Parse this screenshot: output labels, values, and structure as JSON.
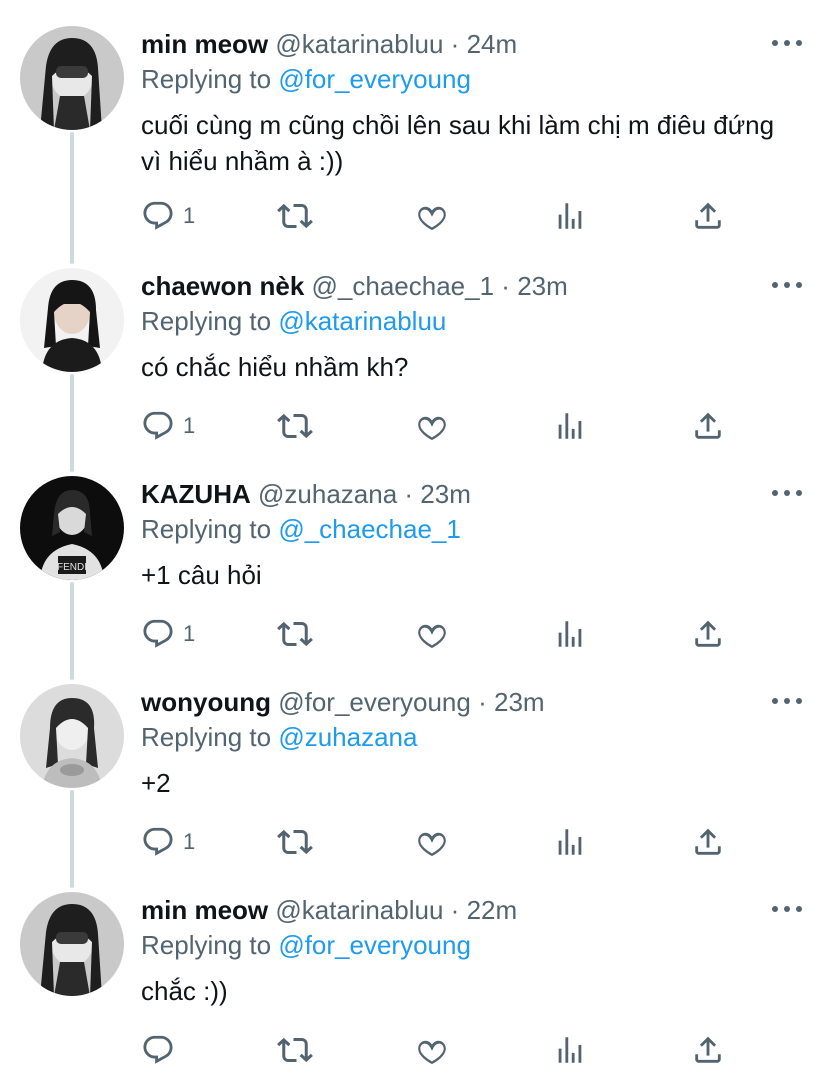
{
  "tweets": [
    {
      "name": "min meow",
      "handle": "@katarinabluu",
      "time": "24m",
      "replying_prefix": "Replying to",
      "replying_to": "@for_everyoung",
      "text": "cuối cùng m cũng chồi lên sau khi làm chị m điêu đứng vì hiểu nhầm à :))",
      "reply_count": "1",
      "avatar": "avatar-bw-girl-hands"
    },
    {
      "name": "chaewon nèk",
      "handle": "@_chaechae_1",
      "time": "23m",
      "replying_prefix": "Replying to",
      "replying_to": "@katarinabluu",
      "text": "có chắc hiểu nhầm kh?",
      "reply_count": "1",
      "avatar": "avatar-girl-black-outfit"
    },
    {
      "name": "KAZUHA",
      "handle": "@zuhazana",
      "time": "23m",
      "replying_prefix": "Replying to",
      "replying_to": "@_chaechae_1",
      "text": "+1 câu hỏi",
      "reply_count": "1",
      "avatar": "avatar-girl-fendi"
    },
    {
      "name": "wonyoung",
      "handle": "@for_everyoung",
      "time": "23m",
      "replying_prefix": "Replying to",
      "replying_to": "@zuhazana",
      "text": "+2",
      "reply_count": "1",
      "avatar": "avatar-girl-bw-portrait"
    },
    {
      "name": "min meow",
      "handle": "@katarinabluu",
      "time": "22m",
      "replying_prefix": "Replying to",
      "replying_to": "@for_everyoung",
      "text": "chắc :))",
      "reply_count": "",
      "avatar": "avatar-bw-girl-hands"
    }
  ],
  "colors": {
    "link": "#1d9bf0",
    "secondary": "#536471",
    "thread_line": "#cfd9de"
  },
  "icons": [
    "reply-icon",
    "retweet-icon",
    "like-icon",
    "analytics-icon",
    "share-icon",
    "more-icon"
  ]
}
